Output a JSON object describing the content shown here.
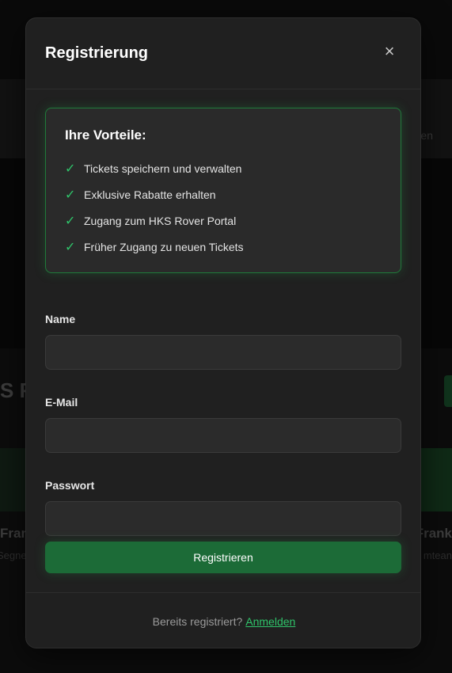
{
  "background": {
    "strip_text": "en",
    "heading": "S F",
    "left_card_title": "Fran",
    "left_card_subtitle": "Segne",
    "right_card_title": "Frank",
    "right_card_subtitle": "mtean"
  },
  "modal": {
    "title": "Registrierung",
    "close_symbol": "×",
    "benefits": {
      "title": "Ihre Vorteile:",
      "check_symbol": "✓",
      "items": [
        {
          "label": "Tickets speichern und verwalten"
        },
        {
          "label": "Exklusive Rabatte erhalten"
        },
        {
          "label": "Zugang zum HKS Rover Portal"
        },
        {
          "label": "Früher Zugang zu neuen Tickets"
        }
      ]
    },
    "form": {
      "name_label": "Name",
      "name_value": "",
      "email_label": "E-Mail",
      "email_value": "",
      "password_label": "Passwort",
      "password_value": ""
    },
    "submit_label": "Registrieren",
    "footer": {
      "question": "Bereits registriert?",
      "login_link": "Anmelden"
    }
  },
  "colors": {
    "accent": "#2fc46a",
    "button": "#1c6b37",
    "modal_bg": "#202020"
  }
}
